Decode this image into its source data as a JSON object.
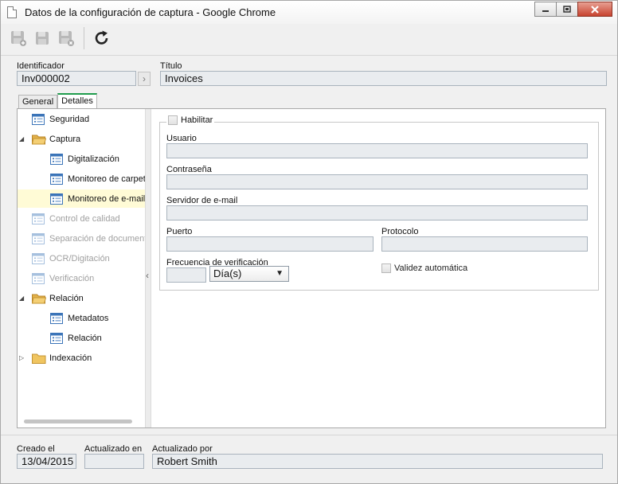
{
  "window": {
    "title": "Datos de la configuración de captura - Google Chrome",
    "minimize_icon": "minimize-icon",
    "restore_icon": "restore-icon",
    "close_icon": "close-icon"
  },
  "toolbar": {
    "buttons": [
      {
        "icon": "save-new-icon",
        "enabled": false
      },
      {
        "icon": "save-icon",
        "enabled": false
      },
      {
        "icon": "save-close-icon",
        "enabled": false
      },
      {
        "icon": "refresh-icon",
        "enabled": true
      }
    ]
  },
  "header": {
    "identifier_label": "Identificador",
    "identifier_value": "Inv000002",
    "title_label": "Título",
    "title_value": "Invoices"
  },
  "tabs": [
    {
      "label": "General",
      "active": false
    },
    {
      "label": "Detalles",
      "active": true
    }
  ],
  "tree": [
    {
      "label": "Seguridad",
      "icon": "form-icon",
      "level": 0,
      "expander": "",
      "state": "normal"
    },
    {
      "label": "Captura",
      "icon": "folder-open-icon",
      "level": 0,
      "expander": "◢",
      "state": "normal"
    },
    {
      "label": "Digitalización",
      "icon": "form-icon",
      "level": 1,
      "expander": "",
      "state": "normal"
    },
    {
      "label": "Monitoreo de carpet",
      "icon": "form-icon",
      "level": 1,
      "expander": "",
      "state": "normal"
    },
    {
      "label": "Monitoreo de e-mail",
      "icon": "form-icon",
      "level": 1,
      "expander": "",
      "state": "selected"
    },
    {
      "label": "Control de calidad",
      "icon": "form-icon",
      "level": 0,
      "expander": "",
      "state": "disabled"
    },
    {
      "label": "Separación de document",
      "icon": "form-icon",
      "level": 0,
      "expander": "",
      "state": "disabled"
    },
    {
      "label": "OCR/Digitación",
      "icon": "form-icon",
      "level": 0,
      "expander": "",
      "state": "disabled"
    },
    {
      "label": "Verificación",
      "icon": "form-icon",
      "level": 0,
      "expander": "",
      "state": "disabled"
    },
    {
      "label": "Relación",
      "icon": "folder-open-icon",
      "level": 0,
      "expander": "◢",
      "state": "normal"
    },
    {
      "label": "Metadatos",
      "icon": "form-icon",
      "level": 1,
      "expander": "",
      "state": "normal"
    },
    {
      "label": "Relación",
      "icon": "form-icon",
      "level": 1,
      "expander": "",
      "state": "normal"
    },
    {
      "label": "Indexación",
      "icon": "folder-closed-icon",
      "level": 0,
      "expander": "▷",
      "state": "normal"
    }
  ],
  "form": {
    "enable_label": "Habilitar",
    "user_label": "Usuario",
    "user_value": "",
    "password_label": "Contraseña",
    "password_value": "",
    "server_label": "Servidor de e-mail",
    "server_value": "",
    "port_label": "Puerto",
    "port_value": "",
    "protocol_label": "Protocolo",
    "protocol_value": "",
    "frequency_label": "Frecuencia de verificación",
    "frequency_value": "",
    "frequency_unit": "Día(s)",
    "auto_validity_label": "Validez automática"
  },
  "footer": {
    "created_label": "Creado el",
    "created_value": "13/04/2015",
    "updated_label": "Actualizado en",
    "updated_value": "",
    "updated_by_label": "Actualizado por",
    "updated_by_value": "Robert Smith"
  }
}
